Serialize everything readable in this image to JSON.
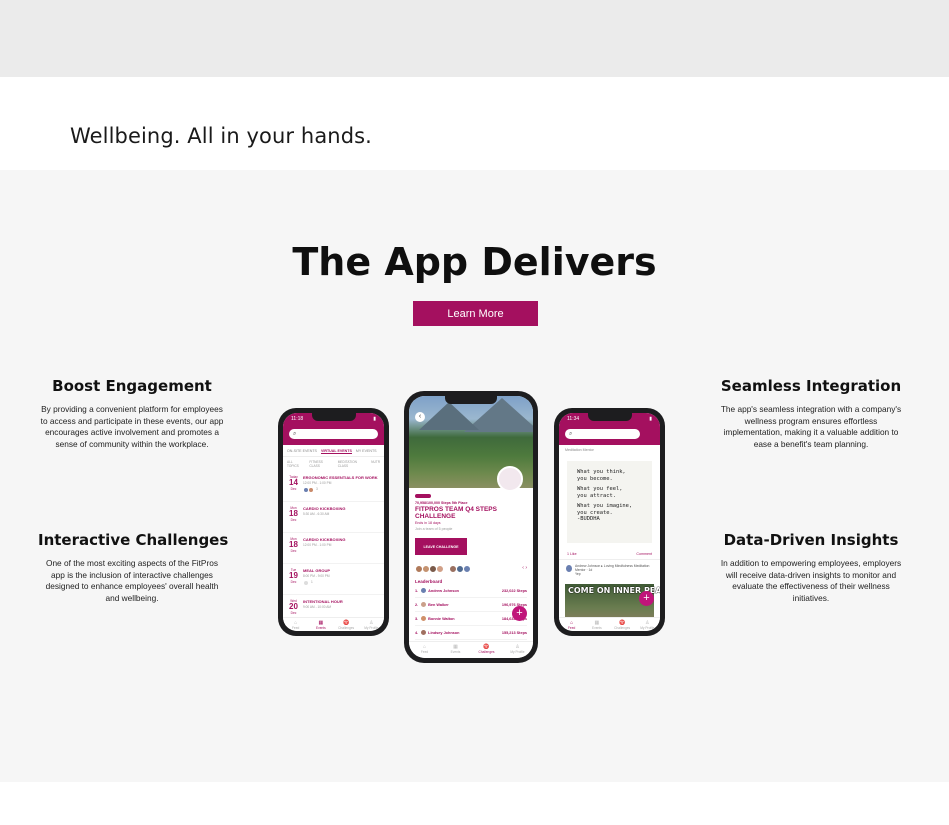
{
  "tagline": "Wellbeing. All in your hands.",
  "section": {
    "title": "The App Delivers",
    "learn_more": "Learn More"
  },
  "features": {
    "boost": {
      "title": "Boost Engagement",
      "body": "By providing a convenient platform for employees to access and participate in these events, our app encourages active involvement and promotes a sense of community within the workplace."
    },
    "interactive": {
      "title": "Interactive Challenges",
      "body": "One of the most exciting aspects of the FitPros app is the inclusion of interactive challenges designed to enhance employees' overall health and wellbeing."
    },
    "seamless": {
      "title": "Seamless Integration",
      "body": "The app's seamless integration with a company's wellness program ensures effortless implementation, making it a valuable addition to ease a benefit's team planning."
    },
    "data": {
      "title": "Data-Driven Insights",
      "body": "In addition to empowering employees, employers will receive data-driven insights to monitor and evaluate the effectiveness of their wellness initiatives."
    }
  },
  "phone_left": {
    "time": "11:18",
    "search_icon": "search-icon",
    "tabs": [
      "ON-SITE EVENTS",
      "VIRTUAL EVENTS",
      "MY EVENTS"
    ],
    "subtabs": [
      "ALL TOPICS",
      "FITNESS CLASS",
      "MEDITATION CLASS",
      "NUTR"
    ],
    "events": [
      {
        "dow": "Today",
        "day": "14",
        "mon": "Dec",
        "title": "ERGONOMIC ESSENTIALS FOR WORK",
        "time": "12:00 PM - 1:00 PM",
        "extra": "3"
      },
      {
        "dow": "Mon",
        "day": "18",
        "mon": "Dec",
        "title": "CARDIO KICKBOXING",
        "time": "5:30 AM - 6:30 AM",
        "extra": ""
      },
      {
        "dow": "Mon",
        "day": "18",
        "mon": "Dec",
        "title": "CARDIO KICKBOXING",
        "time": "12:00 PM - 1:00 PM",
        "extra": ""
      },
      {
        "dow": "Tue",
        "day": "19",
        "mon": "Dec",
        "title": "MEAL GROUP",
        "time": "8:00 PM - 9:00 PM",
        "extra": "1"
      },
      {
        "dow": "Wed",
        "day": "20",
        "mon": "Dec",
        "title": "INTENTIONAL HOUR",
        "time": "9:00 AM - 10:00 AM",
        "extra": ""
      }
    ],
    "nav": [
      "Feed",
      "Events",
      "Challenges",
      "My Profile"
    ]
  },
  "phone_center": {
    "meta": "70,958/100,000 Steps 5th Place",
    "title": "FITPROS TEAM Q4 STEPS CHALLENGE",
    "ends": "Ends in 18 days",
    "join_note": "Join a team of 5 people",
    "leave": "LEAVE CHALLENGE",
    "leaderboard_title": "Leaderboard",
    "leaderboard": [
      {
        "rank": "1.",
        "name": "Andrew Johnson",
        "steps": "232,022 Steps"
      },
      {
        "rank": "2.",
        "name": "Ben Walker",
        "steps": "196,976 Steps"
      },
      {
        "rank": "3.",
        "name": "Bonnie Walton",
        "steps": "184,633 Steps"
      },
      {
        "rank": "4.",
        "name": "Lindsey Johnson",
        "steps": "155,213 Steps"
      }
    ],
    "nav": [
      "Feed",
      "Events",
      "Challenges",
      "My Profile"
    ],
    "fab": "+"
  },
  "phone_right": {
    "time": "11:34",
    "group": "Meditation Mentor",
    "quote": [
      "What you think,",
      "you become.",
      "What you feel,",
      "you attract.",
      "What you imagine,",
      "you create.",
      "-BUDDHA"
    ],
    "likes": "1 Like",
    "comment": "Comment",
    "poster": "Andrew Johnson ▸ Loving Mindfulness Meditation Mentor · 1d",
    "poster_sub": "Yep",
    "meme_text": "COME ON INNER PEACE",
    "nav": [
      "Feed",
      "Events",
      "Challenges",
      "My Profile"
    ],
    "fab": "+"
  },
  "colors": {
    "brand": "#a4105f",
    "band_gray": "#ebebeb",
    "section_bg": "#f6f6f6"
  }
}
